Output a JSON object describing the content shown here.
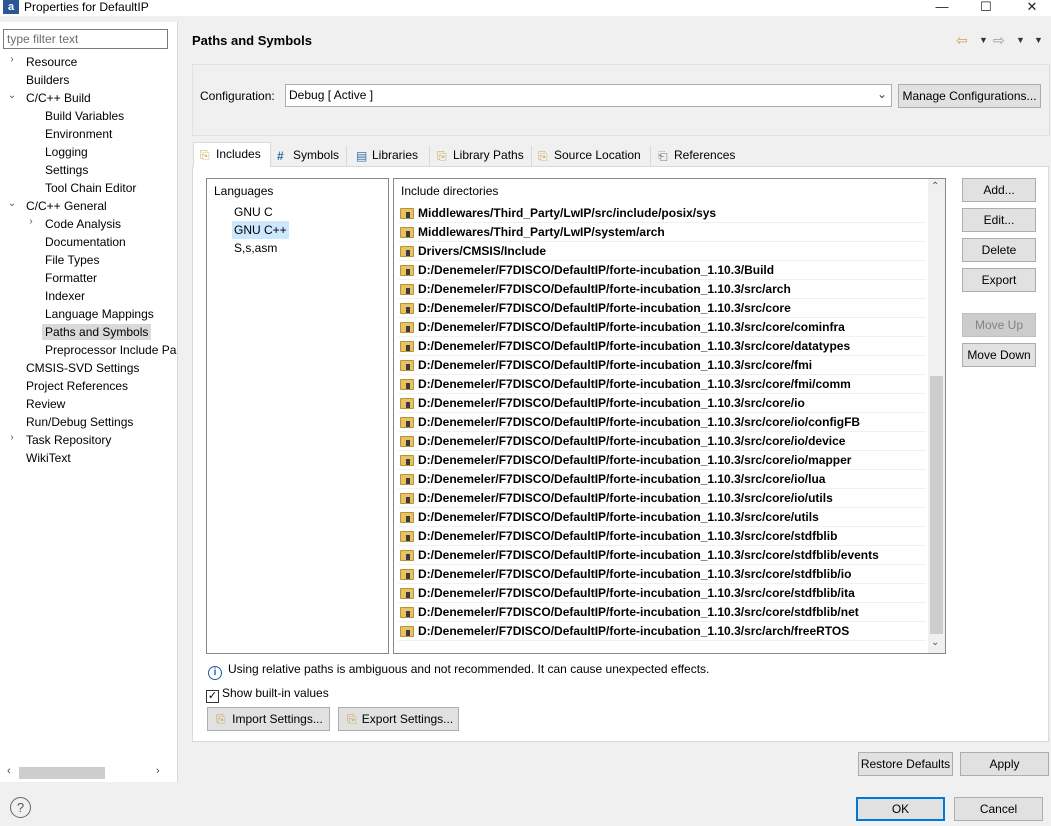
{
  "window": {
    "title": "Properties for DefaultIP",
    "minimize": "—",
    "maximize": "☐",
    "close": "✕"
  },
  "sidebar": {
    "filter_placeholder": "type filter text",
    "items": [
      {
        "label": "Resource",
        "arrow": "›"
      },
      {
        "label": "Builders"
      },
      {
        "label": "C/C++ Build",
        "arrow": "⌄"
      },
      {
        "label": "Build Variables"
      },
      {
        "label": "Environment"
      },
      {
        "label": "Logging"
      },
      {
        "label": "Settings"
      },
      {
        "label": "Tool Chain Editor"
      },
      {
        "label": "C/C++ General",
        "arrow": "⌄"
      },
      {
        "label": "Code Analysis",
        "arrow": "›"
      },
      {
        "label": "Documentation"
      },
      {
        "label": "File Types"
      },
      {
        "label": "Formatter"
      },
      {
        "label": "Indexer"
      },
      {
        "label": "Language Mappings"
      },
      {
        "label": "Paths and Symbols",
        "selected": true
      },
      {
        "label": "Preprocessor Include Pa"
      },
      {
        "label": "CMSIS-SVD Settings"
      },
      {
        "label": "Project References"
      },
      {
        "label": "Review"
      },
      {
        "label": "Run/Debug Settings"
      },
      {
        "label": "Task Repository",
        "arrow": "›"
      },
      {
        "label": "WikiText"
      }
    ]
  },
  "page": {
    "title": "Paths and Symbols"
  },
  "config": {
    "label": "Configuration:",
    "value": "Debug  [ Active ]",
    "manage_button": "Manage Configurations..."
  },
  "tabs": [
    {
      "label": "Includes",
      "icon": "includes-icon",
      "active": true
    },
    {
      "label": "Symbols",
      "icon": "#"
    },
    {
      "label": "Libraries",
      "icon": "libraries-icon"
    },
    {
      "label": "Library Paths",
      "icon": "library-paths-icon"
    },
    {
      "label": "Source Location",
      "icon": "source-location-icon"
    },
    {
      "label": "References",
      "icon": "references-icon"
    }
  ],
  "languages": {
    "header": "Languages",
    "items": [
      "GNU C",
      "GNU C++",
      "S,s,asm"
    ],
    "selected": "GNU C++"
  },
  "includes": {
    "header": "Include directories",
    "items": [
      "Middlewares/Third_Party/LwIP/src/include/posix/sys",
      "Middlewares/Third_Party/LwIP/system/arch",
      "Drivers/CMSIS/Include",
      "D:/Denemeler/F7DISCO/DefaultIP/forte-incubation_1.10.3/Build",
      "D:/Denemeler/F7DISCO/DefaultIP/forte-incubation_1.10.3/src/arch",
      "D:/Denemeler/F7DISCO/DefaultIP/forte-incubation_1.10.3/src/core",
      "D:/Denemeler/F7DISCO/DefaultIP/forte-incubation_1.10.3/src/core/cominfra",
      "D:/Denemeler/F7DISCO/DefaultIP/forte-incubation_1.10.3/src/core/datatypes",
      "D:/Denemeler/F7DISCO/DefaultIP/forte-incubation_1.10.3/src/core/fmi",
      "D:/Denemeler/F7DISCO/DefaultIP/forte-incubation_1.10.3/src/core/fmi/comm",
      "D:/Denemeler/F7DISCO/DefaultIP/forte-incubation_1.10.3/src/core/io",
      "D:/Denemeler/F7DISCO/DefaultIP/forte-incubation_1.10.3/src/core/io/configFB",
      "D:/Denemeler/F7DISCO/DefaultIP/forte-incubation_1.10.3/src/core/io/device",
      "D:/Denemeler/F7DISCO/DefaultIP/forte-incubation_1.10.3/src/core/io/mapper",
      "D:/Denemeler/F7DISCO/DefaultIP/forte-incubation_1.10.3/src/core/io/lua",
      "D:/Denemeler/F7DISCO/DefaultIP/forte-incubation_1.10.3/src/core/io/utils",
      "D:/Denemeler/F7DISCO/DefaultIP/forte-incubation_1.10.3/src/core/utils",
      "D:/Denemeler/F7DISCO/DefaultIP/forte-incubation_1.10.3/src/core/stdfblib",
      "D:/Denemeler/F7DISCO/DefaultIP/forte-incubation_1.10.3/src/core/stdfblib/events",
      "D:/Denemeler/F7DISCO/DefaultIP/forte-incubation_1.10.3/src/core/stdfblib/io",
      "D:/Denemeler/F7DISCO/DefaultIP/forte-incubation_1.10.3/src/core/stdfblib/ita",
      "D:/Denemeler/F7DISCO/DefaultIP/forte-incubation_1.10.3/src/core/stdfblib/net",
      "D:/Denemeler/F7DISCO/DefaultIP/forte-incubation_1.10.3/src/arch/freeRTOS"
    ]
  },
  "side_buttons": {
    "add": "Add...",
    "edit": "Edit...",
    "delete": "Delete",
    "export": "Export",
    "move_up": "Move Up",
    "move_down": "Move Down"
  },
  "info_message": "Using relative paths is ambiguous and not recommended. It can cause unexpected effects.",
  "show_builtin": {
    "label": "Show built-in values",
    "checked": true
  },
  "import_settings": "Import Settings...",
  "export_settings": "Export Settings...",
  "restore_defaults": "Restore Defaults",
  "apply": "Apply",
  "ok": "OK",
  "cancel": "Cancel",
  "help_glyph": "?"
}
